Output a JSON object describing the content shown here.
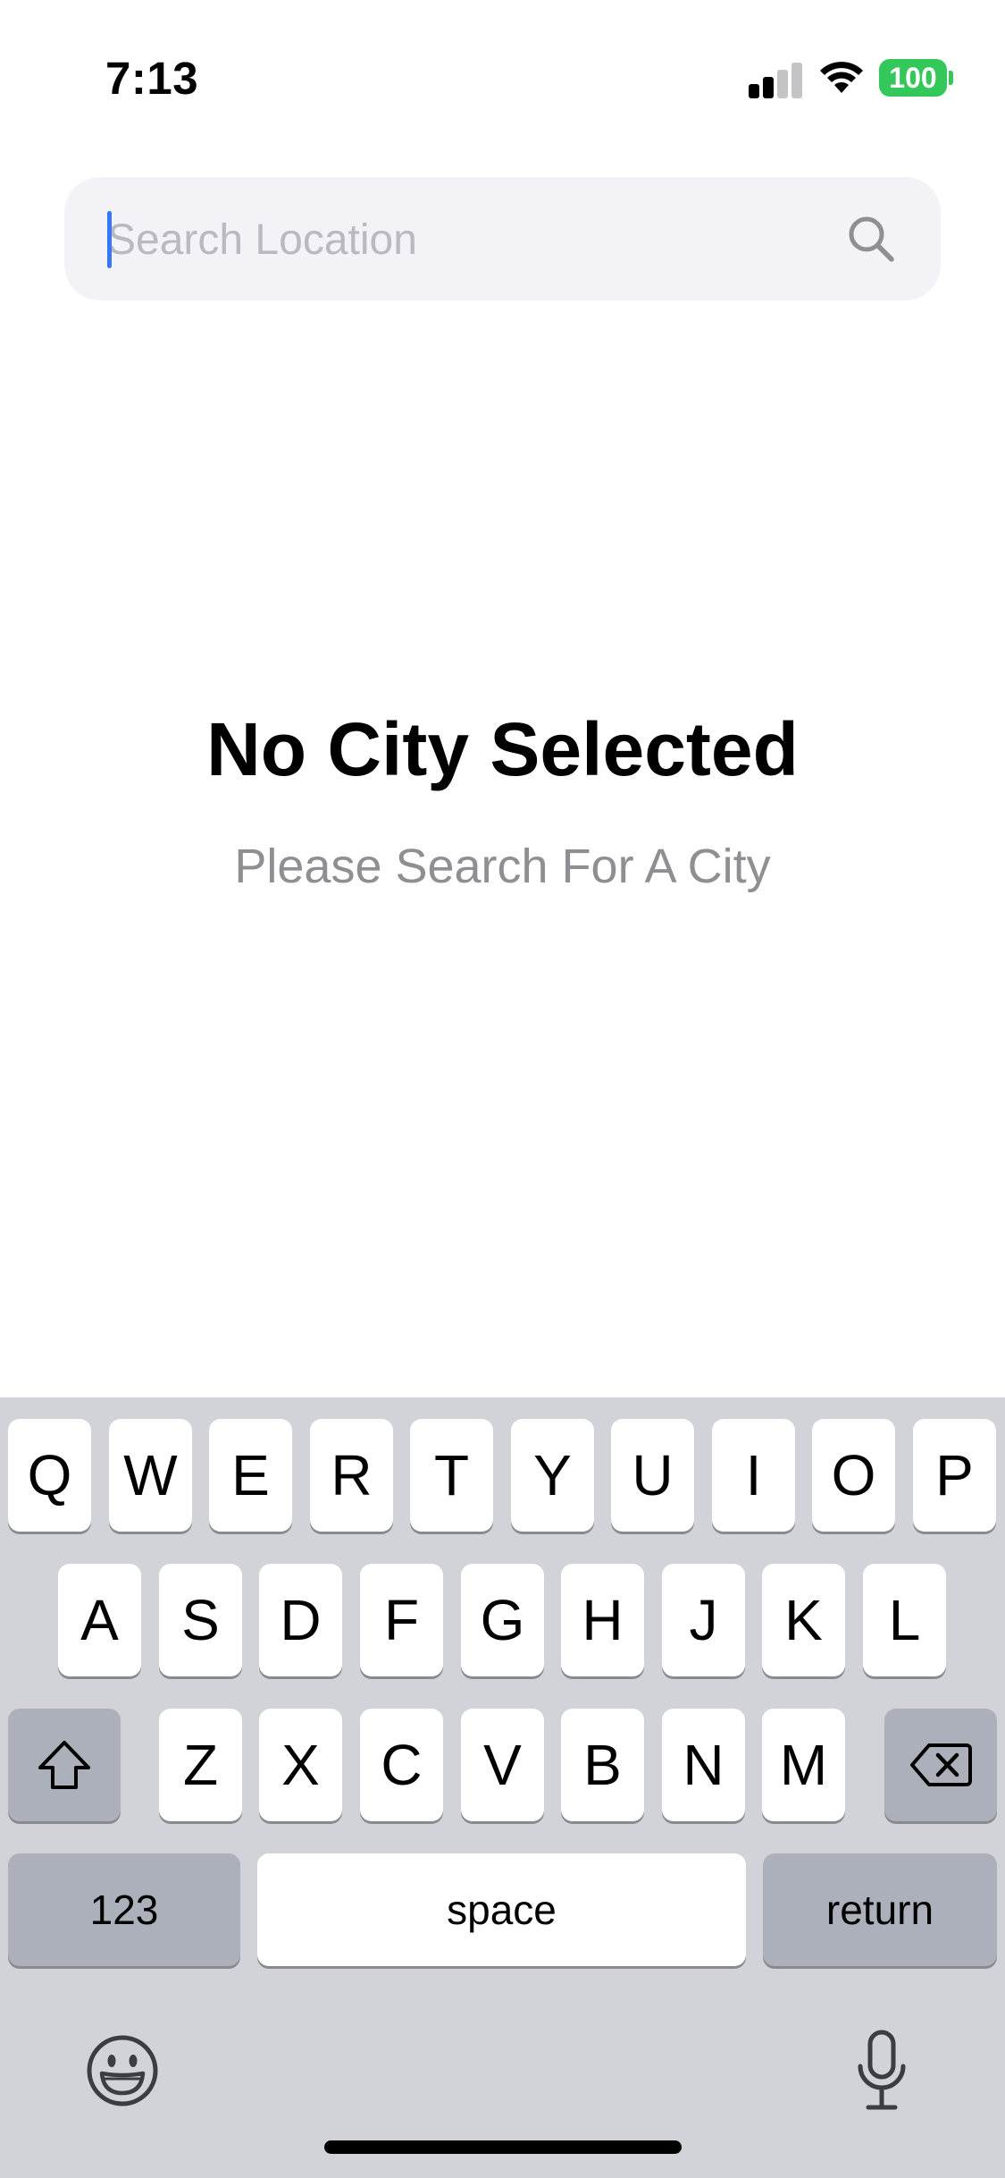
{
  "status_bar": {
    "time": "7:13",
    "battery_level": "100",
    "battery_color": "#34c759",
    "icons": [
      "signal-icon",
      "wifi-icon",
      "battery-icon"
    ]
  },
  "search": {
    "placeholder": "Search Location",
    "value": "",
    "icon": "search-icon"
  },
  "empty_state": {
    "title": "No City Selected",
    "subtitle": "Please Search For A City"
  },
  "keyboard": {
    "row1": [
      "Q",
      "W",
      "E",
      "R",
      "T",
      "Y",
      "U",
      "I",
      "O",
      "P"
    ],
    "row2": [
      "A",
      "S",
      "D",
      "F",
      "G",
      "H",
      "J",
      "K",
      "L"
    ],
    "row3": [
      "Z",
      "X",
      "C",
      "V",
      "B",
      "N",
      "M"
    ],
    "numbers_label": "123",
    "space_label": "space",
    "return_label": "return",
    "icons": [
      "shift-icon",
      "delete-icon",
      "emoji-icon",
      "microphone-icon"
    ]
  },
  "colors": {
    "accent": "#3478f6",
    "keyboard_bg": "#d1d3d9",
    "special_key": "#abb0ba",
    "search_bg": "#f2f2f7"
  }
}
